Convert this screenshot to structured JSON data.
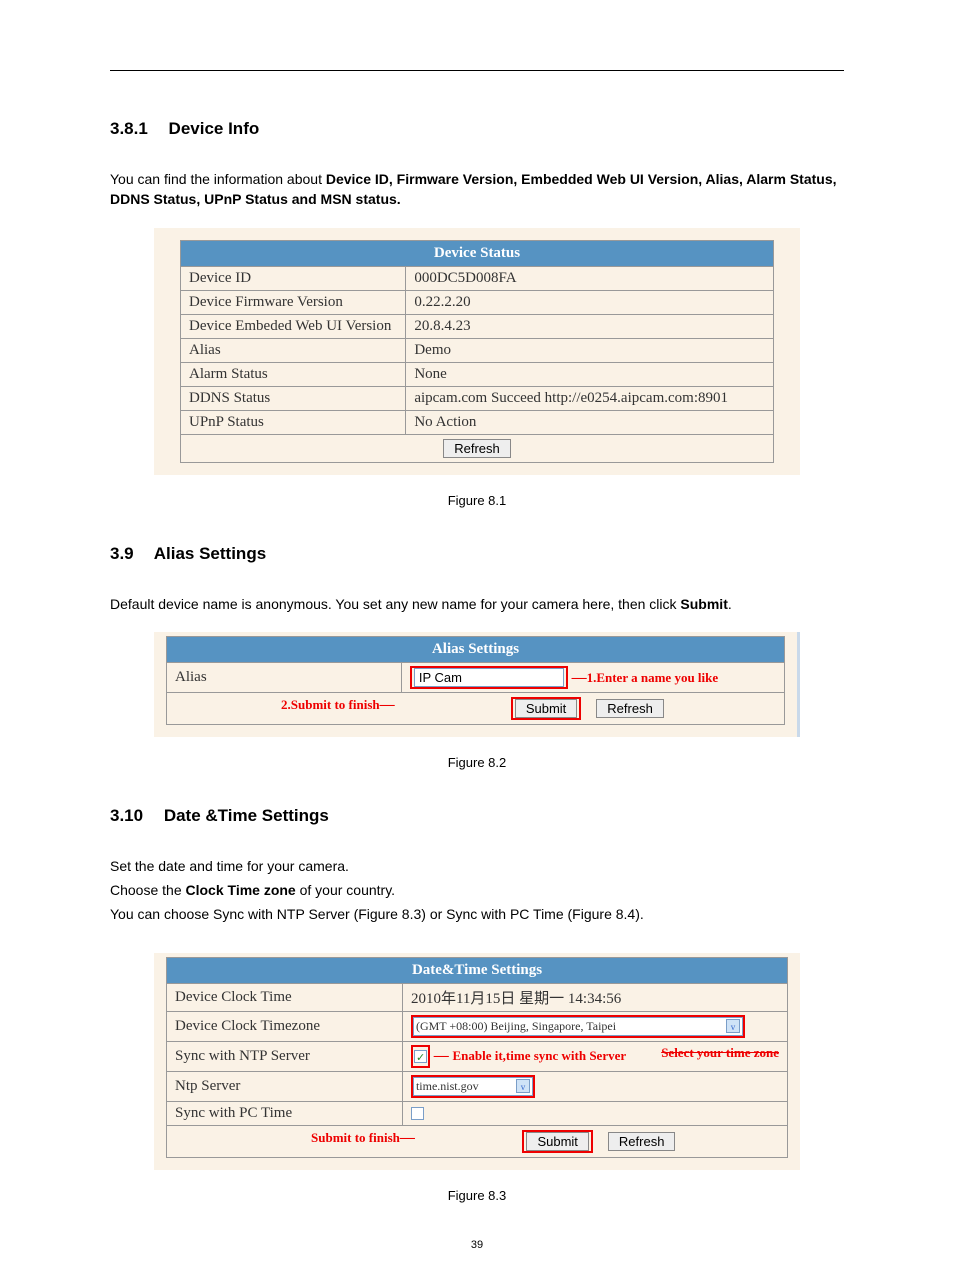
{
  "section1": {
    "num": "3.8.1",
    "title": "Device Info",
    "intro_pre": "You can find the information about ",
    "intro_bold": "Device ID, Firmware Version, Embedded Web UI Version, Alias, Alarm Status, DDNS Status, UPnP Status and MSN status.",
    "table_header": "Device Status",
    "rows": [
      {
        "label": "Device ID",
        "value": "000DC5D008FA"
      },
      {
        "label": "Device Firmware Version",
        "value": "0.22.2.20"
      },
      {
        "label": "Device Embeded Web UI Version",
        "value": "20.8.4.23"
      },
      {
        "label": "Alias",
        "value": "Demo"
      },
      {
        "label": "Alarm Status",
        "value": "None"
      },
      {
        "label": "DDNS Status",
        "value": "aipcam.com  Succeed  http://e0254.aipcam.com:8901"
      },
      {
        "label": "UPnP Status",
        "value": "No Action"
      }
    ],
    "refresh": "Refresh",
    "caption": "Figure 8.1"
  },
  "section2": {
    "num": "3.9",
    "title": "Alias Settings",
    "intro_pre": "Default device name is anonymous. You set any new name for your camera here, then click ",
    "intro_bold": "Submit",
    "intro_post": ".",
    "table_header": "Alias Settings",
    "alias_label": "Alias",
    "alias_value": "IP Cam",
    "annot1": "1.Enter a name you like",
    "annot2": "2.Submit to finish",
    "submit": "Submit",
    "refresh": "Refresh",
    "caption": "Figure 8.2"
  },
  "section3": {
    "num": "3.10",
    "title": "Date &Time Settings",
    "p1": "Set the date and time for your camera.",
    "p2_pre": "Choose the ",
    "p2_bold": "Clock Time zone",
    "p2_post": " of your country.",
    "p3": "You can choose Sync with NTP Server (Figure 8.3) or Sync with PC Time (Figure 8.4).",
    "table_header": "Date&Time Settings",
    "r1_label": "Device Clock Time",
    "r1_value": "2010年11月15日 星期一 14:34:56",
    "r2_label": "Device Clock Timezone",
    "r2_value": "(GMT +08:00) Beijing, Singapore, Taipei",
    "r3_label": "Sync with NTP Server",
    "r3_annot": "Enable it,time sync with Server",
    "r3_annot2": "Select your time zone",
    "r4_label": "Ntp Server",
    "r4_value": "time.nist.gov",
    "r5_label": "Sync with PC Time",
    "annot_submit": "Submit to finish",
    "submit": "Submit",
    "refresh": "Refresh",
    "caption": "Figure 8.3"
  },
  "page_number": "39"
}
